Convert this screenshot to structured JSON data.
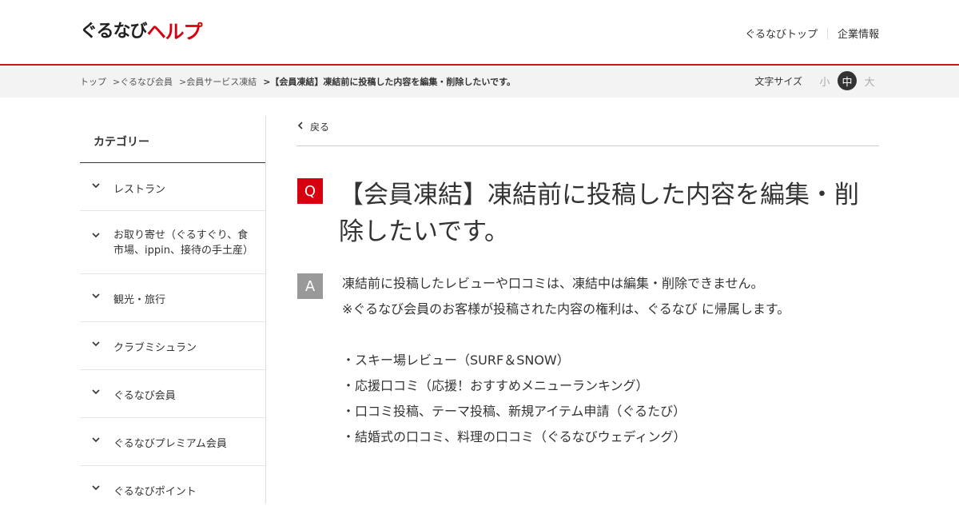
{
  "header": {
    "logo_part1": "ぐるなび",
    "logo_part2": "ヘルプ",
    "nav": [
      "ぐるなびトップ",
      "企業情報"
    ]
  },
  "breadcrumb": {
    "items": [
      "トップ",
      ">ぐるなび会員",
      ">会員サービス凍結",
      ">【会員凍結】凍結前に投稿した内容を編集・削除したいです。"
    ]
  },
  "font_size": {
    "label": "文字サイズ",
    "options": [
      "小",
      "中",
      "大"
    ],
    "selected": "中"
  },
  "sidebar": {
    "title": "カテゴリー",
    "items": [
      {
        "label": "レストラン"
      },
      {
        "label": "お取り寄せ（ぐるすぐり、食市場、ippin、接待の手土産）"
      },
      {
        "label": "観光・旅行"
      },
      {
        "label": "クラブミシュラン"
      },
      {
        "label": "ぐるなび会員"
      },
      {
        "label": "ぐるなびプレミアム会員"
      },
      {
        "label": "ぐるなびポイント"
      }
    ]
  },
  "main": {
    "back_label": "戻る",
    "q_badge": "Q",
    "question": "【会員凍結】凍結前に投稿した内容を編集・削除したいです。",
    "a_badge": "A",
    "answer_lines": [
      "凍結前に投稿したレビューや口コミは、凍結中は編集・削除できません。",
      "※ぐるなび会員のお客様が投稿された内容の権利は、ぐるなび に帰属します。"
    ],
    "answer_list": [
      "・スキー場レビュー（SURF＆SNOW）",
      "・応援口コミ（応援！おすすめメニューランキング）",
      "・口コミ投稿、テーマ投稿、新規アイテム申請（ぐるたび）",
      "・結婚式の口コミ、料理の口コミ（ぐるなびウェディング）"
    ]
  },
  "colors": {
    "brand_red": "#d7000f",
    "answer_badge": "#999999",
    "selected_font_size_bg": "#333333"
  }
}
